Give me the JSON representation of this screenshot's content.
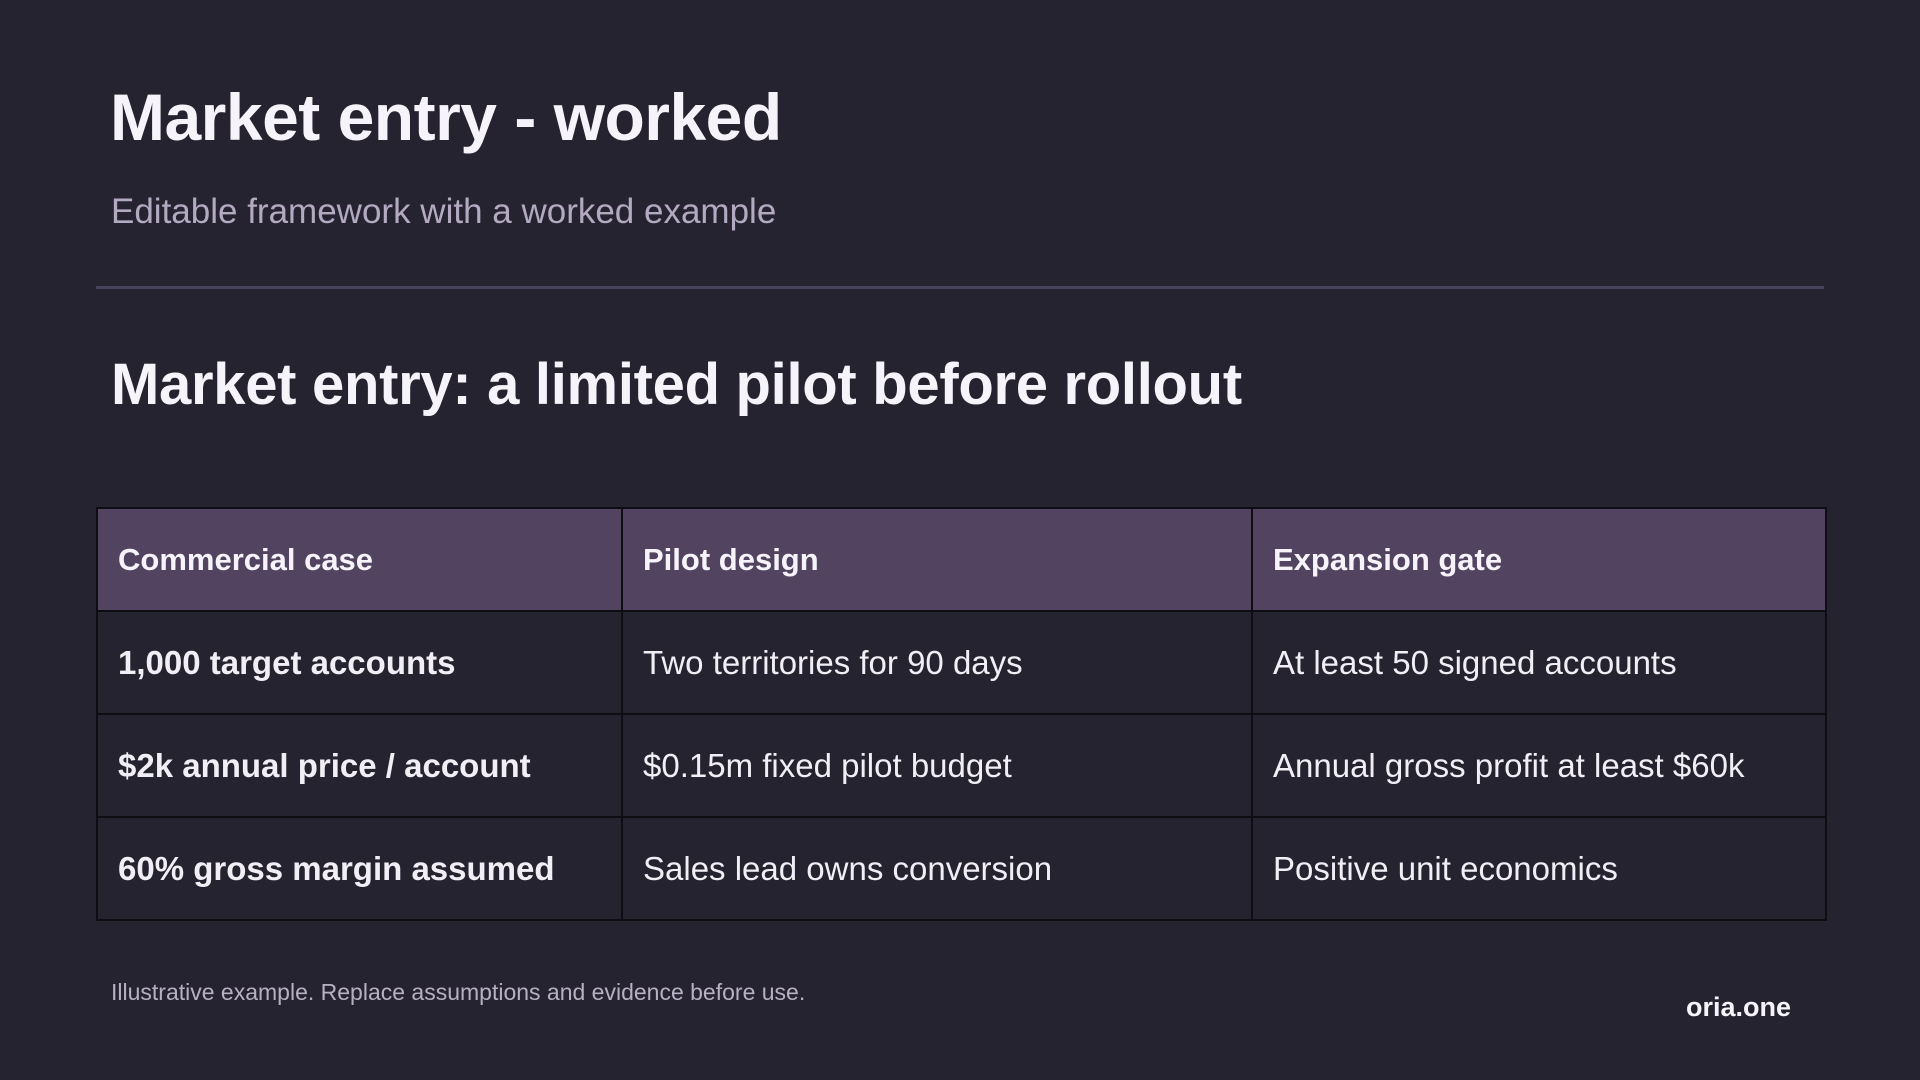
{
  "header": {
    "title": "Market entry - worked",
    "subtitle": "Editable framework with a worked example"
  },
  "section": {
    "heading": "Market entry: a limited pilot before rollout"
  },
  "table": {
    "headers": [
      "Commercial case",
      "Pilot design",
      "Expansion gate"
    ],
    "rows": [
      [
        "1,000 target accounts",
        "Two territories for 90 days",
        "At least 50 signed accounts"
      ],
      [
        "$2k annual price / account",
        "$0.15m fixed pilot budget",
        "Annual gross profit at least $60k"
      ],
      [
        "60% gross margin assumed",
        "Sales lead owns conversion",
        "Positive unit economics"
      ]
    ]
  },
  "footer": {
    "note": "Illustrative example. Replace assumptions and evidence before use.",
    "brand": "oria.one"
  },
  "colors": {
    "background": "#262331",
    "header_fill": "#524460",
    "divider": "#48435a",
    "subtitle_text": "#b3aac2"
  }
}
